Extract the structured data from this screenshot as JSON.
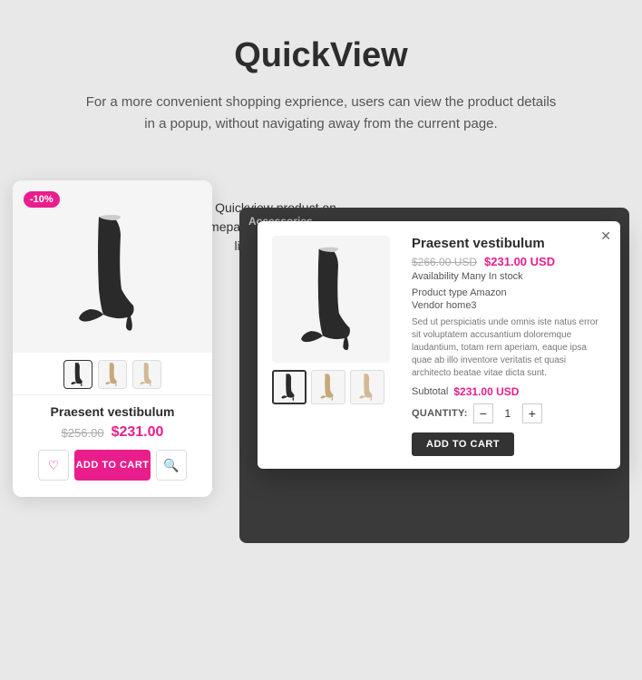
{
  "header": {
    "title": "QuickView",
    "description": "For a more convenient shopping exprience, users can view the product details in a popup, without navigating away from the current page."
  },
  "callout": {
    "text": "Quickview product on homepage/listing page in the lightbox popup"
  },
  "product_card": {
    "discount": "-10%",
    "name": "Praesent vestibulum",
    "old_price": "$256.00",
    "new_price": "$231.00",
    "wishlist_icon": "♡",
    "add_to_cart_label": "ADD TO CART",
    "search_icon": "🔍"
  },
  "lightbox": {
    "close_label": "✕",
    "product_name": "Praesent vestibulum",
    "old_price": "$266.00 USD",
    "new_price": "$231.00 USD",
    "availability": "Availability Many In stock",
    "product_type": "Product type Amazon",
    "vendor": "Vendor home3",
    "description": "Sed ut perspiciatis unde omnis iste natus error sit voluptatem accusantium doloremque laudantium, totam rem aperiam, eaque ipsa quae ab illo inventore veritatis et quasi architecto beatae vitae dicta sunt.",
    "subtotal_label": "Subtotal",
    "subtotal_value": "$231.00 USD",
    "quantity_label": "QUANTITY:",
    "quantity_value": "1",
    "add_to_cart_label": "ADD TO CART"
  },
  "category_label": "Accessories",
  "colors": {
    "accent": "#e91e8c",
    "dark": "#2d2d2d",
    "bg": "#e8e8e8"
  }
}
